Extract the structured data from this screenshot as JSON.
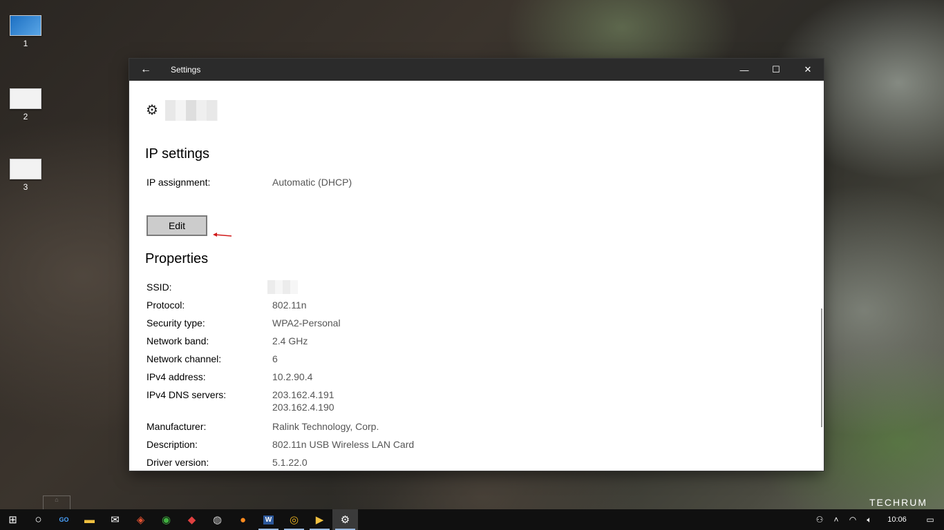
{
  "desktop": {
    "icons": [
      {
        "label": "1",
        "icon": "desktop-thumb-1"
      },
      {
        "label": "2",
        "icon": "desktop-thumb-2"
      },
      {
        "label": "3",
        "icon": "desktop-thumb-3"
      }
    ],
    "watermark": "TECHRUM"
  },
  "window": {
    "title": "Settings",
    "back_icon": "arrow-left",
    "controls": {
      "minimize": "—",
      "maximize": "☐",
      "close": "✕"
    }
  },
  "page": {
    "gear_icon": "⚙",
    "ip_settings": {
      "title": "IP settings",
      "assignment_label": "IP assignment:",
      "assignment_value": "Automatic (DHCP)",
      "edit_label": "Edit"
    },
    "properties": {
      "title": "Properties",
      "items": [
        {
          "label": "SSID:",
          "value": ""
        },
        {
          "label": "Protocol:",
          "value": "802.11n"
        },
        {
          "label": "Security type:",
          "value": "WPA2-Personal"
        },
        {
          "label": "Network band:",
          "value": "2.4 GHz"
        },
        {
          "label": "Network channel:",
          "value": "6"
        },
        {
          "label": "IPv4 address:",
          "value": "10.2.90.4"
        },
        {
          "label": "IPv4 DNS servers:",
          "value": "203.162.4.191",
          "value2": "203.162.4.190"
        },
        {
          "label": "Manufacturer:",
          "value": "Ralink Technology, Corp."
        },
        {
          "label": "Description:",
          "value": "802.11n USB Wireless LAN Card"
        },
        {
          "label": "Driver version:",
          "value": "5.1.22.0"
        }
      ]
    }
  },
  "taskbar": {
    "apps": [
      "windows-start",
      "cortana",
      "gotv",
      "file-explorer",
      "mail",
      "app-1",
      "app-2",
      "app-3",
      "app-4",
      "firefox",
      "word",
      "chrome",
      "media-player",
      "settings"
    ],
    "clock": "10:06"
  },
  "accent_colors": {
    "arrow": "#d11a1a",
    "titlebar": "#2b2b2b",
    "taskbar": "#101010"
  }
}
